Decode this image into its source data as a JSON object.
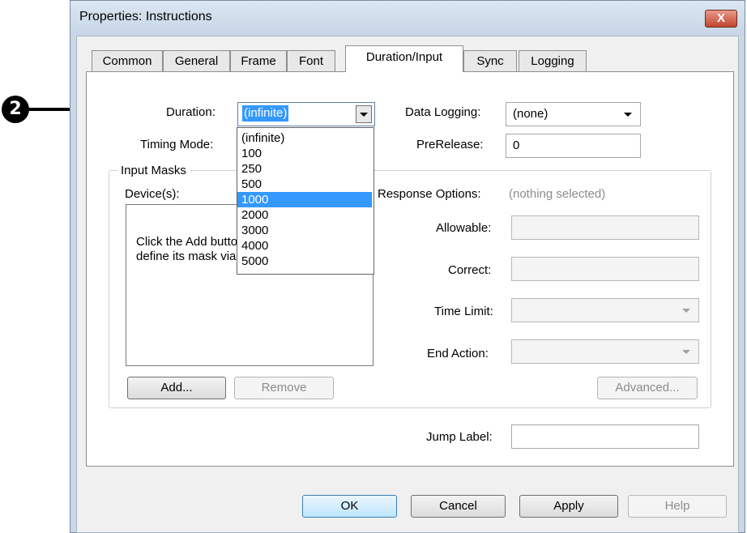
{
  "callout": {
    "number": "2"
  },
  "window": {
    "title": "Properties: Instructions",
    "close_label": "X"
  },
  "tabs": [
    {
      "label": "Common"
    },
    {
      "label": "General"
    },
    {
      "label": "Frame"
    },
    {
      "label": "Font"
    },
    {
      "label": "Duration/Input",
      "active": true
    },
    {
      "label": "Sync"
    },
    {
      "label": "Logging"
    }
  ],
  "duration": {
    "label": "Duration:",
    "value": "(infinite)",
    "options": [
      "(infinite)",
      "100",
      "250",
      "500",
      "1000",
      "2000",
      "3000",
      "4000",
      "5000"
    ],
    "highlighted": "1000"
  },
  "timing_mode": {
    "label": "Timing Mode:"
  },
  "data_logging": {
    "label": "Data Logging:",
    "value": "(none)"
  },
  "prerelease": {
    "label": "PreRelease:",
    "value": "0"
  },
  "input_masks": {
    "group_label": "Input Masks",
    "devices_label": "Device(s):",
    "list_hint": "Click the Add button to add a device and define its mask via Response Options",
    "add_button": "Add...",
    "remove_button": "Remove"
  },
  "response_options": {
    "label": "Response Options:",
    "status": "(nothing selected)",
    "allowable_label": "Allowable:",
    "correct_label": "Correct:",
    "time_limit_label": "Time Limit:",
    "end_action_label": "End Action:",
    "advanced_button": "Advanced..."
  },
  "jump_label": {
    "label": "Jump Label:",
    "value": ""
  },
  "footer": {
    "ok": "OK",
    "cancel": "Cancel",
    "apply": "Apply",
    "help": "Help"
  }
}
